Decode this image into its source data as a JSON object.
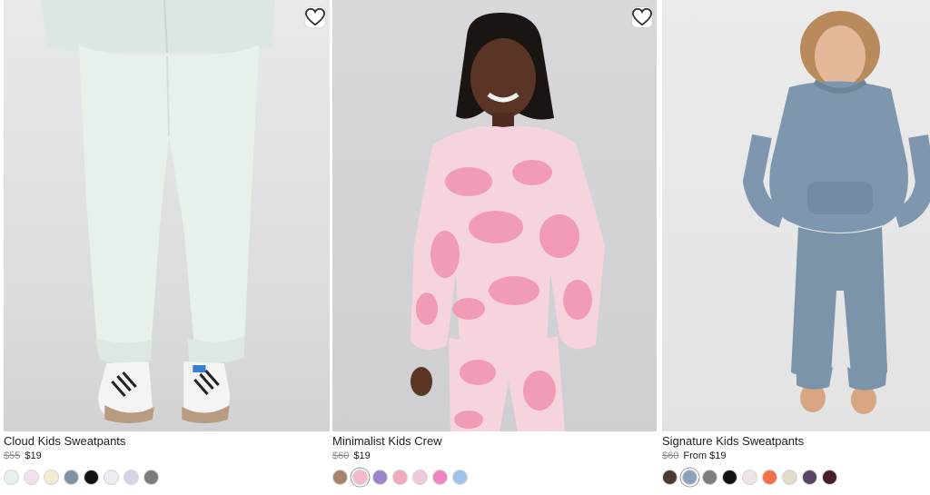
{
  "colors": {
    "accent": "#1c1c1c",
    "muted": "#8a8a8a"
  },
  "products": [
    {
      "title": "Cloud Kids Sweatpants",
      "old_price": "$55",
      "new_price": "$19",
      "wishlist_icon": "heart-icon",
      "swatches": [
        "#e6f1ea",
        "#f1e1ec",
        "#f2ecd0",
        "#7f93a8",
        "#111111",
        "#ececf3",
        "#d6d3e6",
        "#7b7b7b"
      ]
    },
    {
      "title": "Minimalist Kids Crew",
      "old_price": "$60",
      "new_price": "$19",
      "wishlist_icon": "heart-icon",
      "swatches": [
        "#a8826b",
        "#f6b8cf",
        "#9d84cf",
        "#f2a8bd",
        "#f0c8dc",
        "#ee85c3",
        "#9ec3ea"
      ]
    },
    {
      "title": "Signature Kids Sweatpants",
      "old_price": "$60",
      "new_price": "From $19",
      "swatches": [
        "#4c3a31",
        "#8aa3bd",
        "#7d7d7d",
        "#111111",
        "#f0e4ea",
        "#f2704a",
        "#e3dccb",
        "#574466",
        "#4a1c28"
      ]
    }
  ]
}
